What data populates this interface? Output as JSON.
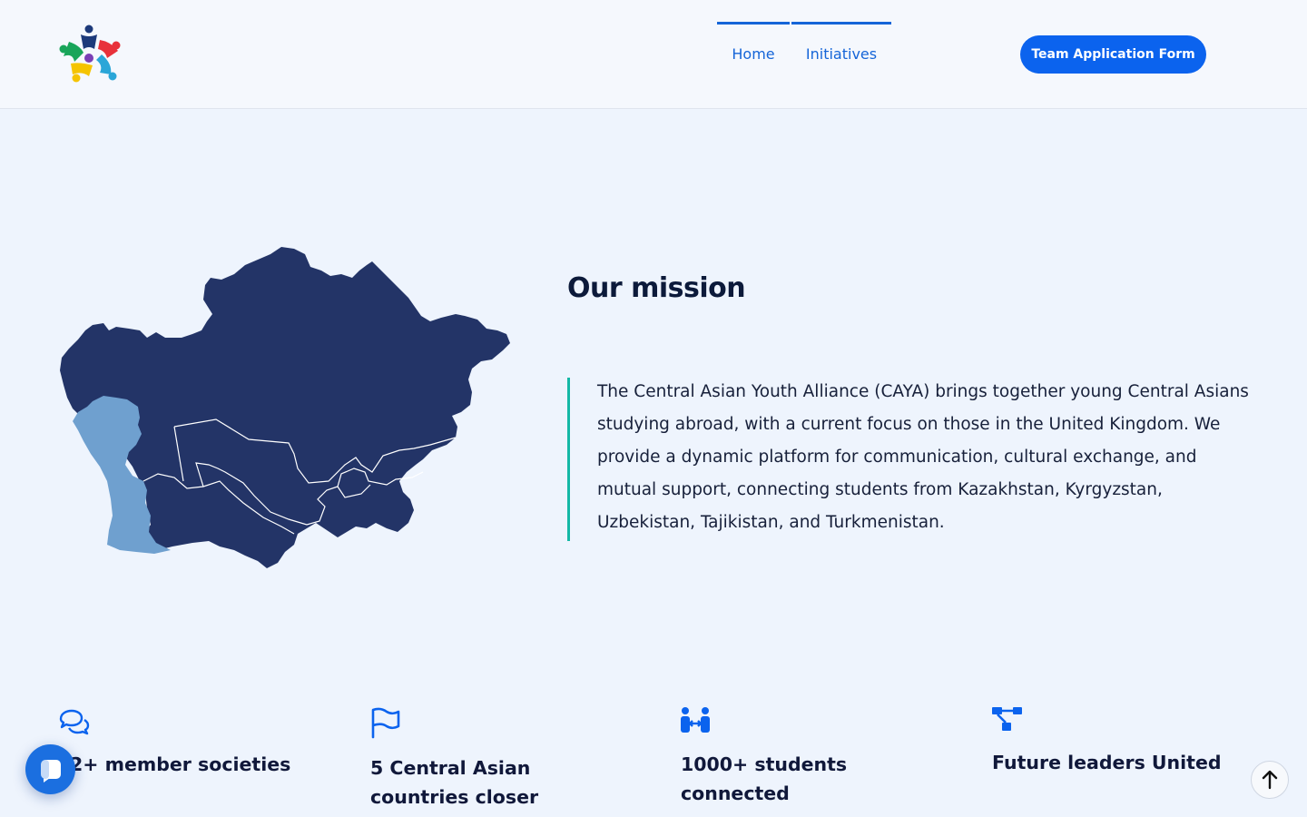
{
  "brand": {
    "logo_name": "caya-logo",
    "colors": [
      "#1d3a7a",
      "#e8313a",
      "#19a55a",
      "#f5c400",
      "#2aa6d8",
      "#7a3fb5"
    ]
  },
  "nav": {
    "items": [
      {
        "label": "Home"
      },
      {
        "label": "Initiatives"
      }
    ]
  },
  "header": {
    "cta_label": "Team Application Form"
  },
  "mission": {
    "title": "Our mission",
    "text": "The Central Asian Youth Alliance (CAYA) brings together young Central Asians studying abroad, with a current focus on those in the United Kingdom. We provide a dynamic platform for communication, cultural exchange, and mutual support, connecting students from Kazakhstan, Kyrgyzstan, Uzbekistan, Tajikistan, and Turkmenistan."
  },
  "stats": [
    {
      "icon": "chat-bubbles-icon",
      "label": "2+ member societies"
    },
    {
      "icon": "flag-icon",
      "label": "5 Central Asian countries closer"
    },
    {
      "icon": "people-exchange-icon",
      "label": "1000+ students connected"
    },
    {
      "icon": "network-icon",
      "label": "Future leaders United"
    }
  ],
  "colors": {
    "accent": "#0b63ee",
    "nav_text": "#1565d8",
    "map_main": "#233467",
    "map_caspian": "#6fa0cf",
    "mission_border": "#14b8a6",
    "page_bg": "#eef4fd"
  },
  "widgets": {
    "chat_icon": "chat-icon",
    "scroll_top_icon": "arrow-up-icon"
  }
}
